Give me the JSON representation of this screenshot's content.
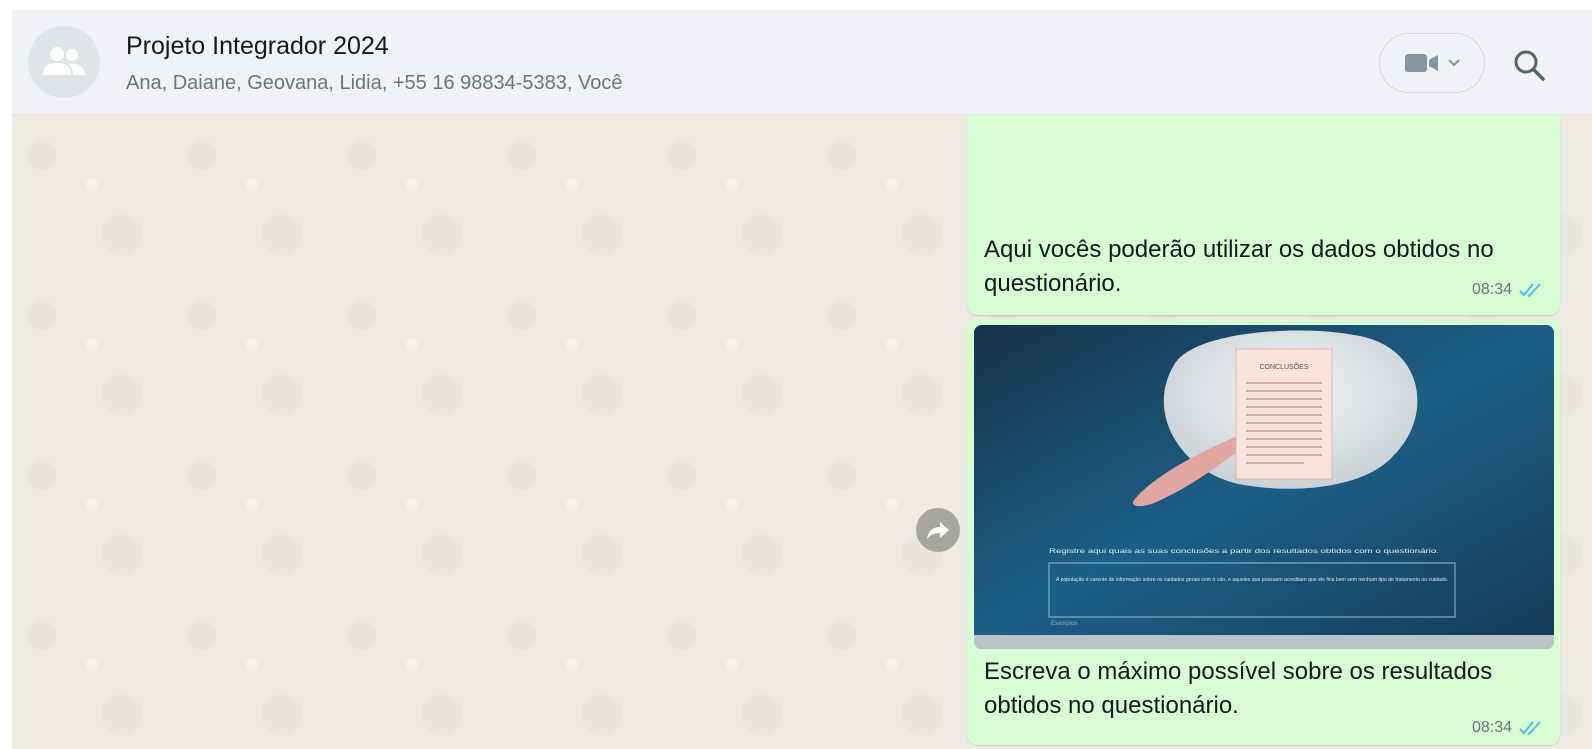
{
  "header": {
    "avatar_icon": "group-icon",
    "title": "Projeto Integrador 2024",
    "participants": "Ana, Daiane, Geovana, Lidia, +55 16 98834-5383, Você",
    "video_icon": "video-camera-icon",
    "dropdown_icon": "chevron-down-icon",
    "search_icon": "search-icon"
  },
  "messages": [
    {
      "text": "Aqui vocês poderão utilizar os dados obtidos no questionário.",
      "time": "08:34",
      "status_icon": "double-check-read-icon"
    },
    {
      "image": {
        "heading": "CONCLUSÕES",
        "prompt": "Registre aqui quais as suas conclusões a partir dos resultados obtidos com o questionário.",
        "answer": "A população é carente de informação sobre os cuidados gerais com o cão, e aqueles que possuem acreditam que ele fica bem sem nenhum tipo de tratamento ou cuidado.",
        "footer": "Exemplos"
      },
      "text": "Escreva o máximo possível sobre os resultados obtidos no questionário.",
      "time": "08:34",
      "status_icon": "double-check-read-icon"
    }
  ],
  "forward_icon": "forward-icon",
  "colors": {
    "header_bg": "#f0f2f5",
    "chat_bg": "#efeae2",
    "outgoing_bubble": "#d9fdd3",
    "read_ticks": "#53bdeb"
  }
}
